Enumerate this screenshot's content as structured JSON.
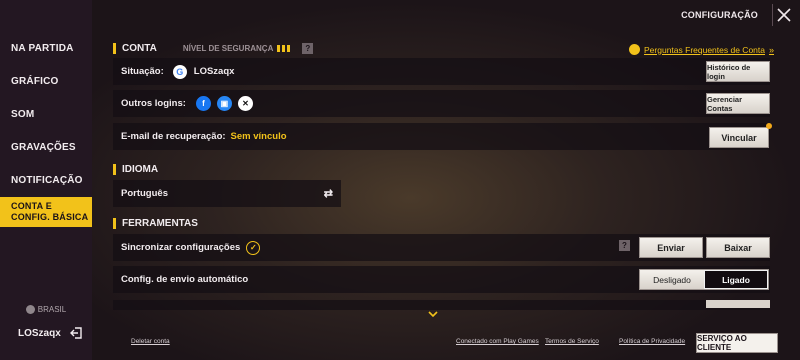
{
  "header": {
    "title": "CONFIGURAÇÃO",
    "close_icon": "close-icon"
  },
  "sidebar": {
    "items": [
      {
        "label": "NA PARTIDA",
        "active": false
      },
      {
        "label": "GRÁFICO",
        "active": false
      },
      {
        "label": "SOM",
        "active": false
      },
      {
        "label": "GRAVAÇÕES",
        "active": false
      },
      {
        "label": "NOTIFICAÇÃO",
        "active": false
      },
      {
        "label_line1": "CONTA E",
        "label_line2": "CONFIG. BÁSICA",
        "active": true
      }
    ],
    "region": "BRASIL",
    "username": "LOSzaqx"
  },
  "account": {
    "section_title": "CONTA",
    "security_label": "NÍVEL DE SEGURANÇA",
    "faq_link": "Perguntas Frequentes de Conta",
    "status_label": "Situação:",
    "status_value": "LOSzaqx",
    "login_history_button": "Histórico de login",
    "other_logins_label": "Outros logins:",
    "manage_accounts_button": "Gerenciar Contas",
    "recovery_email_label": "E-mail de recuperação:",
    "recovery_email_value": "Sem vínculo",
    "link_button": "Vincular"
  },
  "language": {
    "section_title": "IDIOMA",
    "current": "Português"
  },
  "tools": {
    "section_title": "FERRAMENTAS",
    "sync_label": "Sincronizar configurações",
    "send_button": "Enviar",
    "download_button": "Baixar",
    "auto_send_label": "Config. de envio automático",
    "toggle_off": "Desligado",
    "toggle_on": "Ligado",
    "toggle_selected": "Ligado"
  },
  "footer": {
    "delete_account": "Deletar conta",
    "connected": "Conectado com Play Games",
    "terms": "Termos de Serviço",
    "privacy": "Política de Privacidade",
    "customer_service": "SERVIÇO AO CLIENTE"
  },
  "colors": {
    "accent": "#f2c21a",
    "sidebar_bg": "#231722",
    "row_bg": "#140e14"
  }
}
